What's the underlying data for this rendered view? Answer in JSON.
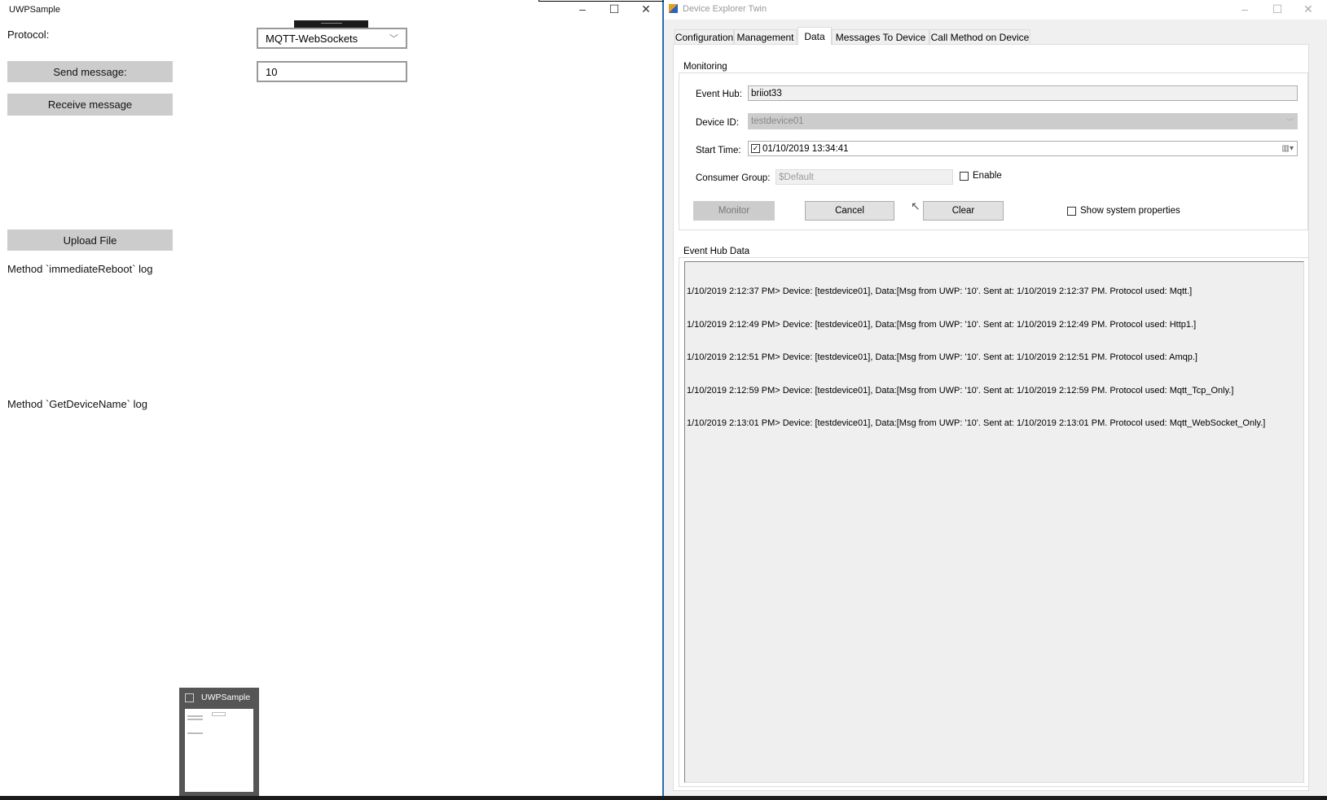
{
  "uwp": {
    "title": "UWPSample",
    "protocol_label": "Protocol:",
    "protocol_value": "MQTT-WebSockets",
    "send_label": "Send message:",
    "message_value": "10",
    "receive_label": "Receive message",
    "upload_label": "Upload File",
    "reboot_log_label": "Method `immediateReboot` log",
    "devicename_log_label": "Method `GetDeviceName` log",
    "thumbnail_title": "UWPSample"
  },
  "det": {
    "title": "Device Explorer Twin",
    "tabs": [
      "Configuration",
      "Management",
      "Data",
      "Messages To Device",
      "Call Method on Device"
    ],
    "active_tab": "Data",
    "monitoring": {
      "title": "Monitoring",
      "event_hub_label": "Event Hub:",
      "event_hub_value": "briiot33",
      "device_id_label": "Device ID:",
      "device_id_value": "testdevice01",
      "start_time_label": "Start Time:",
      "start_time_value": "01/10/2019 13:34:41",
      "start_time_checked": true,
      "consumer_group_label": "Consumer Group:",
      "consumer_group_value": "$Default",
      "enable_label": "Enable",
      "enable_checked": false,
      "monitor_label": "Monitor",
      "cancel_label": "Cancel",
      "clear_label": "Clear",
      "show_sys_props_label": "Show system properties",
      "show_sys_props_checked": false
    },
    "event_hub_data": {
      "title": "Event Hub Data",
      "lines": [
        "1/10/2019 2:12:37 PM> Device: [testdevice01], Data:[Msg from UWP: '10'. Sent at: 1/10/2019 2:12:37 PM. Protocol used: Mqtt.]",
        "1/10/2019 2:12:49 PM> Device: [testdevice01], Data:[Msg from UWP: '10'. Sent at: 1/10/2019 2:12:49 PM. Protocol used: Http1.]",
        "1/10/2019 2:12:51 PM> Device: [testdevice01], Data:[Msg from UWP: '10'. Sent at: 1/10/2019 2:12:51 PM. Protocol used: Amqp.]",
        "1/10/2019 2:12:59 PM> Device: [testdevice01], Data:[Msg from UWP: '10'. Sent at: 1/10/2019 2:12:59 PM. Protocol used: Mqtt_Tcp_Only.]",
        "1/10/2019 2:13:01 PM> Device: [testdevice01], Data:[Msg from UWP: '10'. Sent at: 1/10/2019 2:13:01 PM. Protocol used: Mqtt_WebSocket_Only.]"
      ]
    }
  }
}
